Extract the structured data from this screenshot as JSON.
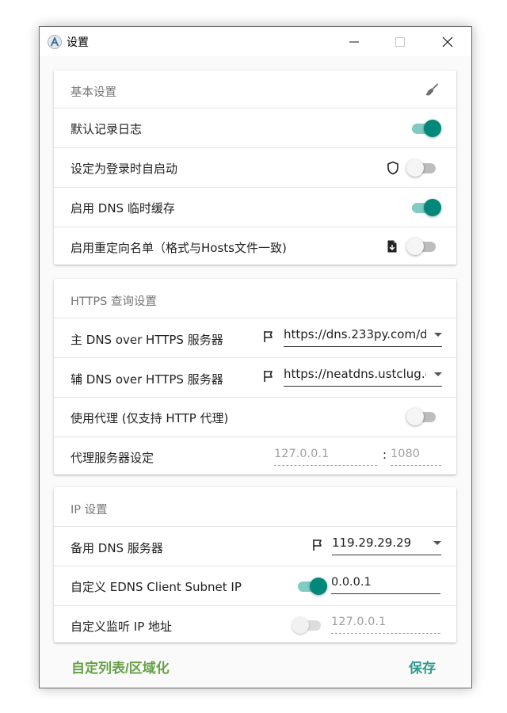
{
  "window": {
    "title": "设置",
    "app_icon_letter": "A"
  },
  "basic": {
    "header": "基本设置",
    "rows": [
      {
        "label": "默认记录日志",
        "switch": "on"
      },
      {
        "label": "设定为登录时自启动",
        "icon": "shield-icon",
        "switch": "off"
      },
      {
        "label": "启用 DNS 临时缓存",
        "switch": "on"
      },
      {
        "label": "启用重定向名单（格式与Hosts文件一致)",
        "icon": "file-import-icon",
        "switch": "off"
      }
    ]
  },
  "https": {
    "header": "HTTPS 查询设置",
    "primary_label": "主 DNS over HTTPS 服务器",
    "primary_value": "https://dns.233py.com/d",
    "secondary_label": "辅 DNS over HTTPS 服务器",
    "secondary_value": "https://neatdns.ustclug.o",
    "proxy_label": "使用代理 (仅支持 HTTP 代理)",
    "proxy_switch": "off",
    "proxy_server_label": "代理服务器设定",
    "proxy_host": "127.0.0.1",
    "proxy_colon": ":",
    "proxy_port": "1080"
  },
  "ip": {
    "header": "IP 设置",
    "backup_label": "备用 DNS 服务器",
    "backup_value": "119.29.29.29",
    "edns_label": "自定义 EDNS Client Subnet IP",
    "edns_switch": "on",
    "edns_value": "0.0.0.1",
    "listen_label": "自定义监听 IP 地址",
    "listen_switch": "off-disabled",
    "listen_value": "127.0.0.1"
  },
  "footer": {
    "left_button": "自定列表/区域化",
    "right_button": "保存"
  },
  "colors": {
    "accent": "#00897b",
    "accent_light": "#80cbc4",
    "footer_left": "#66a046",
    "footer_right": "#2e9a8e"
  }
}
